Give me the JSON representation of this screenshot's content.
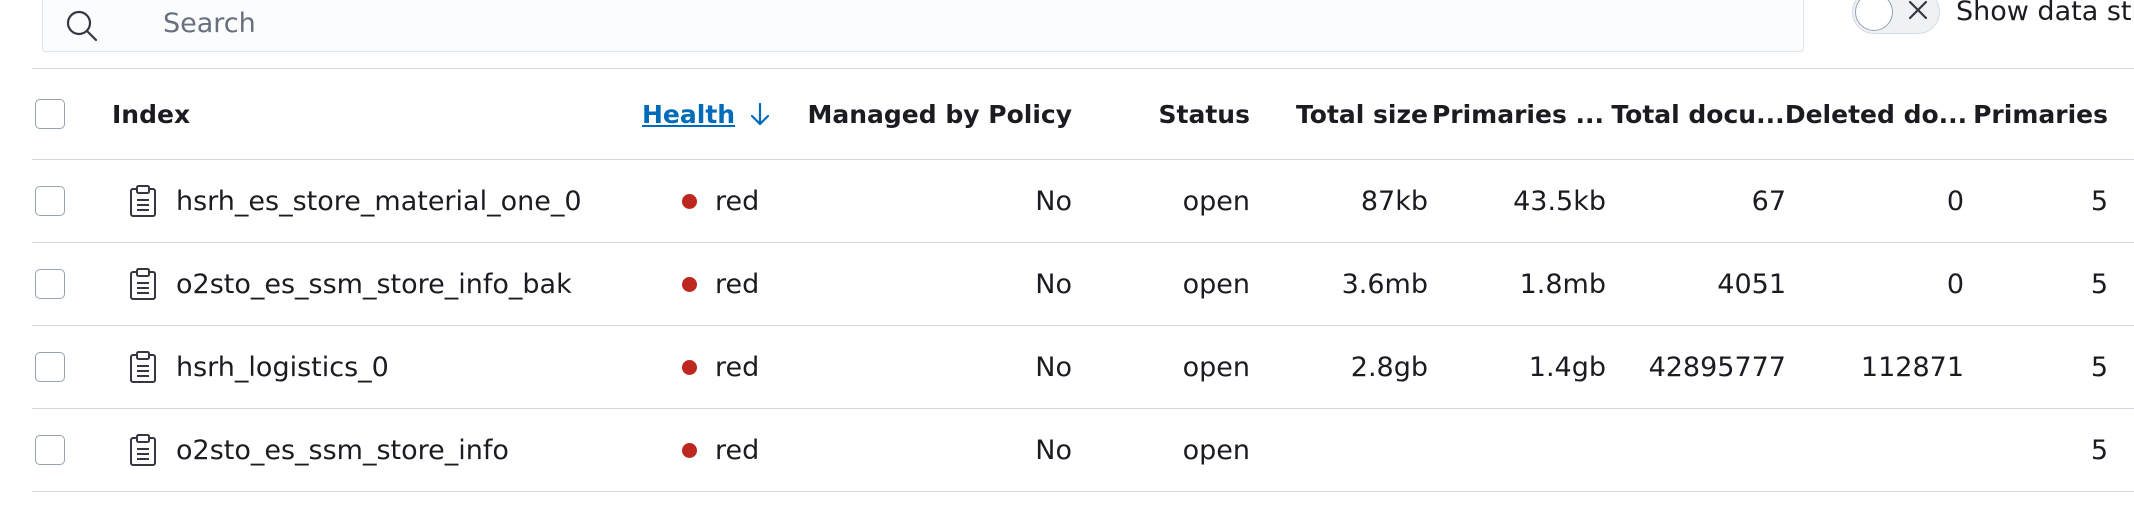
{
  "search": {
    "placeholder": "Search"
  },
  "toggle": {
    "label": "Show data str"
  },
  "table": {
    "headers": {
      "index": "Index",
      "health": "Health",
      "managed": "Managed by Policy",
      "status": "Status",
      "total_size": "Total size",
      "primaries_size": "Primaries ...",
      "total_docs": "Total docu...",
      "deleted_docs": "Deleted do...",
      "primaries": "Primaries"
    },
    "rows": [
      {
        "index": "hsrh_es_store_material_one_0",
        "health": "red",
        "managed": "No",
        "status": "open",
        "total_size": "87kb",
        "primaries_size": "43.5kb",
        "total_docs": "67",
        "deleted_docs": "0",
        "primaries": "5"
      },
      {
        "index": "o2sto_es_ssm_store_info_bak",
        "health": "red",
        "managed": "No",
        "status": "open",
        "total_size": "3.6mb",
        "primaries_size": "1.8mb",
        "total_docs": "4051",
        "deleted_docs": "0",
        "primaries": "5"
      },
      {
        "index": "hsrh_logistics_0",
        "health": "red",
        "managed": "No",
        "status": "open",
        "total_size": "2.8gb",
        "primaries_size": "1.4gb",
        "total_docs": "42895777",
        "deleted_docs": "112871",
        "primaries": "5"
      },
      {
        "index": "o2sto_es_ssm_store_info",
        "health": "red",
        "managed": "No",
        "status": "open",
        "total_size": "",
        "primaries_size": "",
        "total_docs": "",
        "deleted_docs": "",
        "primaries": "5"
      }
    ]
  },
  "colors": {
    "health_red": "#bd271e",
    "link": "#006bb8"
  },
  "icons": {
    "search": "search-icon",
    "toggle_off": "cross-icon",
    "sort": "arrow-down-icon",
    "index": "clipboard-icon"
  }
}
